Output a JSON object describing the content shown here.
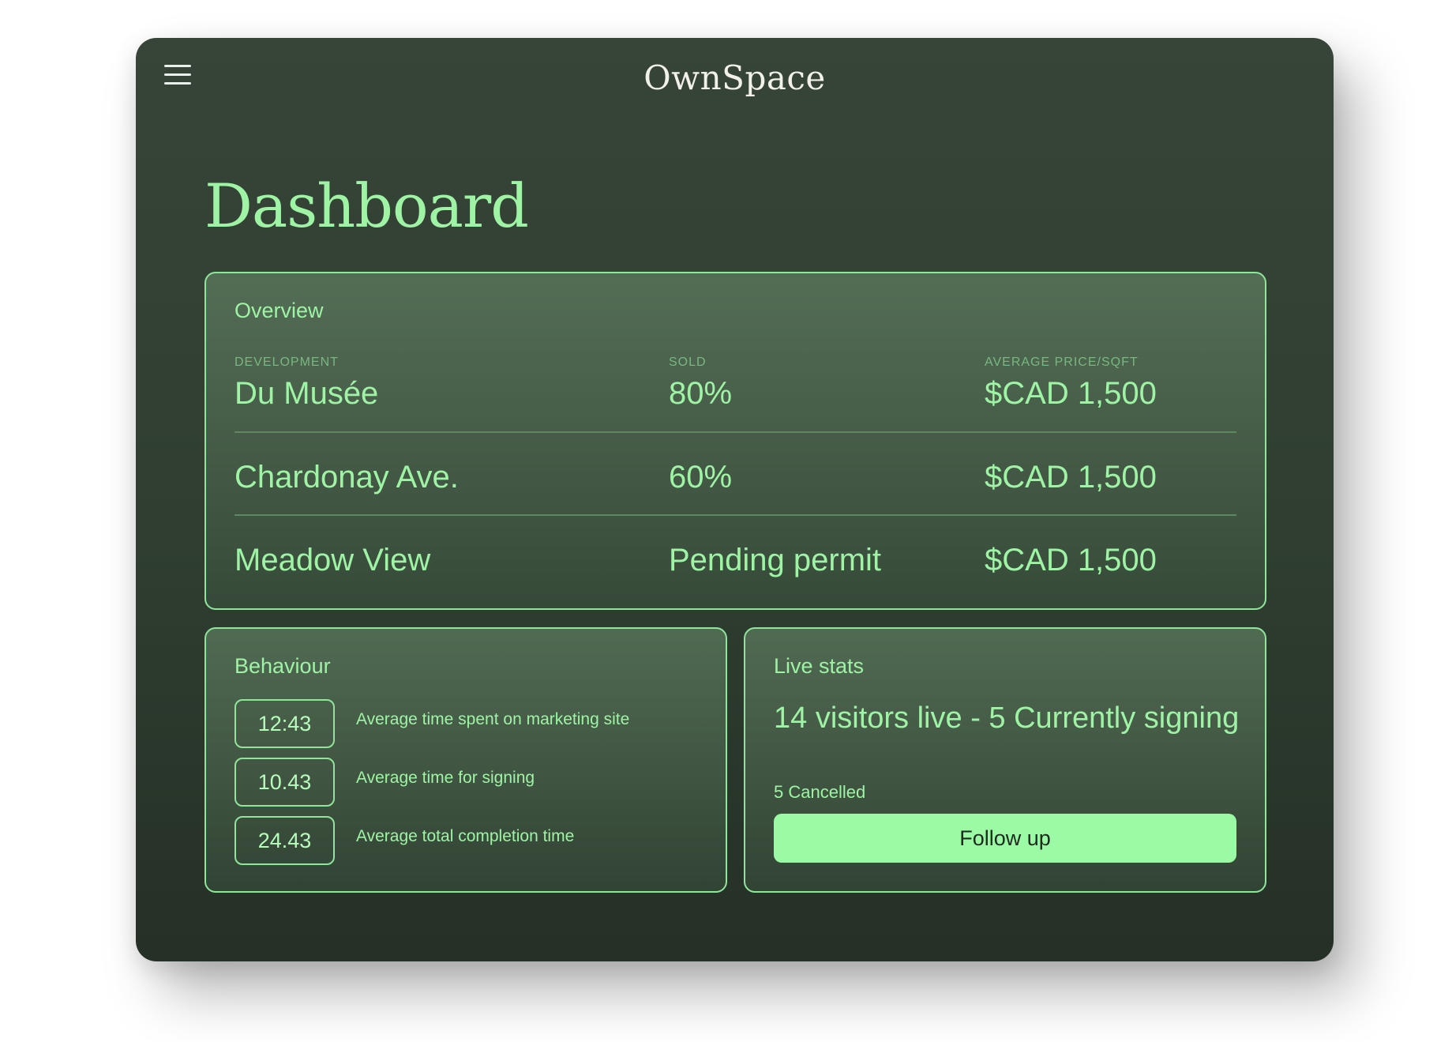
{
  "app": {
    "logo_text": "OwnSpace"
  },
  "page": {
    "title": "Dashboard"
  },
  "overview": {
    "title": "Overview",
    "columns": [
      "DEVELOPMENT",
      "SOLD",
      "AVERAGE PRICE/SQFT"
    ],
    "rows": [
      {
        "development": "Du Musée",
        "sold": "80%",
        "price": "$CAD 1,500"
      },
      {
        "development": "Chardonay Ave.",
        "sold": "60%",
        "price": "$CAD 1,500"
      },
      {
        "development": "Meadow View",
        "sold": "Pending permit",
        "price": "$CAD 1,500"
      }
    ]
  },
  "behaviour": {
    "title": "Behaviour",
    "metrics": [
      {
        "value": "12:43",
        "label": "Average time spent on marketing site"
      },
      {
        "value": "10.43",
        "label": "Average time for signing"
      },
      {
        "value": "24.43",
        "label": "Average total completion time"
      }
    ]
  },
  "live_stats": {
    "title": "Live stats",
    "headline": "14 visitors live - 5 Currently signing",
    "cancelled": "5 Cancelled",
    "button_label": "Follow up"
  },
  "icons": {
    "menu": "hamburger-menu-icon"
  },
  "colors": {
    "accent": "#9ef4a4",
    "background": "#334134",
    "button": "#9bfba4"
  }
}
